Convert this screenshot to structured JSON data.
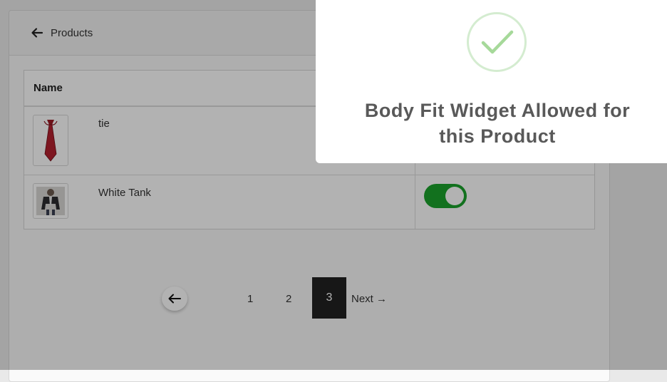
{
  "header": {
    "back_label": "Products"
  },
  "table": {
    "column_name": "Name",
    "rows": [
      {
        "name": "tie",
        "thumbnail_icon": "red-tie"
      },
      {
        "name": "White Tank",
        "thumbnail_icon": "jacket-person",
        "toggle_on": true
      }
    ]
  },
  "pagination": {
    "pages": [
      "1",
      "2",
      "3"
    ],
    "current": "3",
    "next_label": "Next →"
  },
  "toast": {
    "message": "Body Fit Widget Allowed for this Product",
    "icon": "check-circle-icon"
  },
  "colors": {
    "toggle_on": "#1ba22b",
    "current_page_bg": "#222222",
    "check": "#a6d99a"
  }
}
